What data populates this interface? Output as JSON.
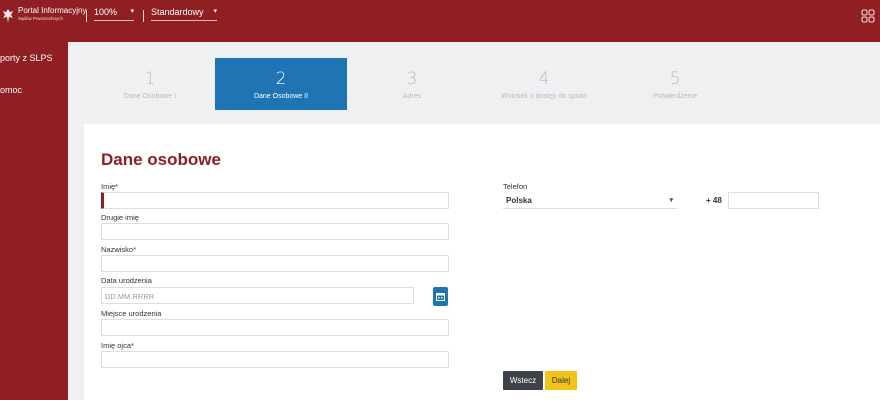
{
  "header": {
    "portal_title": "Portal Informacyjny",
    "portal_subtitle": "Sądów Powszechnych",
    "zoom": "100%",
    "view_mode": "Standardowy"
  },
  "sidebar": {
    "items": [
      {
        "label": "porty z SLPS"
      },
      {
        "label": "omoc"
      }
    ]
  },
  "stepper": {
    "steps": [
      {
        "num": "1",
        "label": "Dane Osobowe I"
      },
      {
        "num": "2",
        "label": "Dane Osobowe II"
      },
      {
        "num": "3",
        "label": "Adres"
      },
      {
        "num": "4",
        "label": "Wniosek o dostęp do spraw"
      },
      {
        "num": "5",
        "label": "Potwierdzenie"
      }
    ],
    "active_index": 1
  },
  "form": {
    "title": "Dane osobowe",
    "first_name_label": "Imię*",
    "first_name_value": "",
    "middle_name_label": "Drugie imię",
    "surname_label": "Nazwisko*",
    "birth_date_label": "Data urodzenia",
    "birth_date_placeholder": "DD.MM.RRRR",
    "birth_place_label": "Miejsce urodzenia",
    "father_name_label": "Imię ojca*",
    "phone_label": "Telefon",
    "country_value": "Polska",
    "phone_prefix": "+ 48",
    "phone_value": ""
  },
  "buttons": {
    "back": "Wstecz",
    "next": "Dalej"
  },
  "colors": {
    "brand": "#8f1f22",
    "accent": "#1f74b4",
    "next_button": "#f2c318",
    "back_button": "#3d4348"
  }
}
